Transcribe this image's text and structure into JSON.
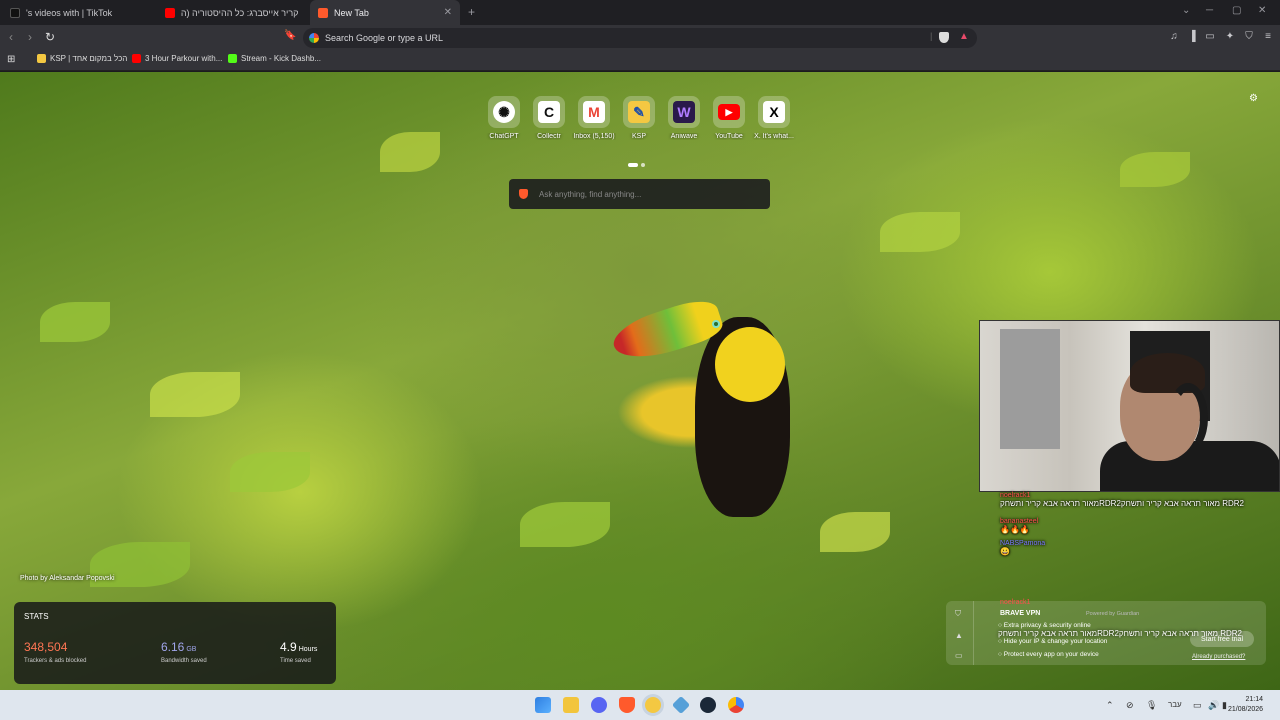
{
  "tabs": [
    {
      "title": "'s videos with | TikTok",
      "icon": "tiktok-icon",
      "color": "#111111"
    },
    {
      "title": "אבא קריר אייסברג: כל ההיסטוריה (ה...",
      "icon": "youtube-icon",
      "color": "#ff0000"
    },
    {
      "title": "New Tab",
      "icon": "brave-icon",
      "color": "#ff5a2c"
    }
  ],
  "address_bar": {
    "placeholder": "Search Google or type a URL"
  },
  "bookmarks": [
    {
      "label": "KSP | הכל במקום אחד",
      "color": "#f4c842"
    },
    {
      "label": "3 Hour Parkour with...",
      "color": "#ff0000"
    },
    {
      "label": "Stream - Kick Dashb...",
      "color": "#53fc18"
    }
  ],
  "shortcuts": [
    {
      "label": "ChatGPT",
      "glyph": "✺",
      "bg": "#ffffff",
      "fg": "#111111"
    },
    {
      "label": "Collectr",
      "glyph": "C",
      "bg": "#ffffff",
      "fg": "#111111"
    },
    {
      "label": "Inbox (5,150)",
      "glyph": "M",
      "bg": "#ffffff",
      "fg": "#ea4335"
    },
    {
      "label": "KSP",
      "glyph": "✎",
      "bg": "#f4c842",
      "fg": "#1e4fa8"
    },
    {
      "label": "Aniwave",
      "glyph": "W",
      "bg": "#2a1a4a",
      "fg": "#b07cff"
    },
    {
      "label": "YouTube",
      "glyph": "▶",
      "bg": "#ffffff",
      "fg": "#ff0000"
    },
    {
      "label": "X. It's what...",
      "glyph": "X",
      "bg": "#ffffff",
      "fg": "#000000"
    }
  ],
  "search": {
    "placeholder": "Ask anything, find anything..."
  },
  "photo_credit": "Photo by Aleksandar Popovski",
  "stats": {
    "title": "STATS",
    "trackers": {
      "value": "348,504",
      "caption": "Trackers & ads blocked",
      "color": "#ff7654"
    },
    "bandwidth": {
      "value": "6.16",
      "unit": "GB",
      "caption": "Bandwidth saved",
      "color": "#a0a5eb"
    },
    "time": {
      "value": "4.9",
      "unit": "Hours",
      "caption": "Time saved",
      "color": "#ffffff"
    }
  },
  "chat": {
    "name1": "noelrack1",
    "msg1": "מאור תראה אבא קריר ותשחקRDR2מאור תראה אבא קריר ותשחק RDR2",
    "name2": "bananasteel",
    "name3": "NABSPamona",
    "name4": "noelrack1",
    "msg2": "מאור תראה אבא קריר ותשחקRDR2מאור תראה אבא קריר ותשחק RDR2"
  },
  "vpn": {
    "title": "BRAVE VPN",
    "powered": "Powered by Guardian",
    "line1": "Extra privacy & security online",
    "line2": "Hide your IP & change your location",
    "line3": "Protect every app on your device",
    "button": "Start free trial",
    "link": "Already purchased?"
  },
  "taskbar": {
    "language": "עבר",
    "time": "21:14",
    "date": "21/08/2026"
  }
}
